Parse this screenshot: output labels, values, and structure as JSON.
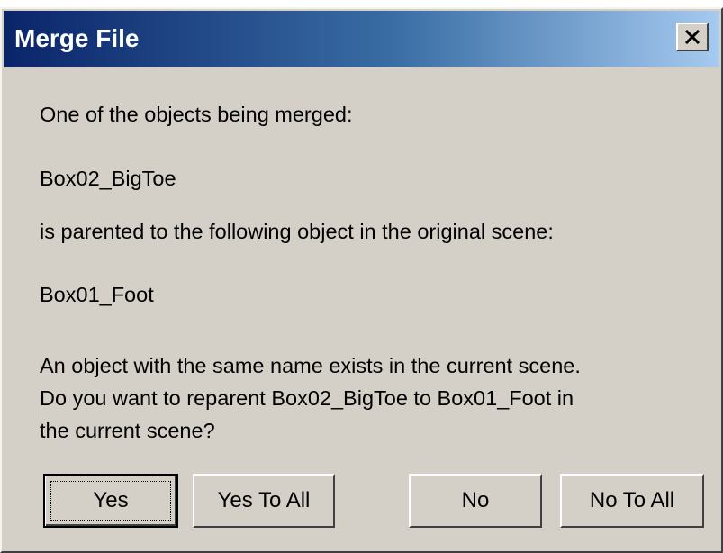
{
  "window": {
    "title": "Merge File",
    "close_icon": "close-icon"
  },
  "message": {
    "line1": "One of the objects being merged:",
    "object_name": "Box02_BigToe",
    "line3": "is parented to the following object in the original scene:",
    "parent_name": "Box01_Foot",
    "question_lines": [
      "An object with the same name exists in the current scene.",
      "Do you want to reparent Box02_BigToe to Box01_Foot in",
      "the current scene?"
    ]
  },
  "buttons": {
    "yes": "Yes",
    "yes_to_all": "Yes To All",
    "no": "No",
    "no_to_all": "No To All"
  },
  "colors": {
    "dialog_bg": "#d4d0c8",
    "title_start": "#0a246a",
    "title_end": "#a6caf0"
  }
}
